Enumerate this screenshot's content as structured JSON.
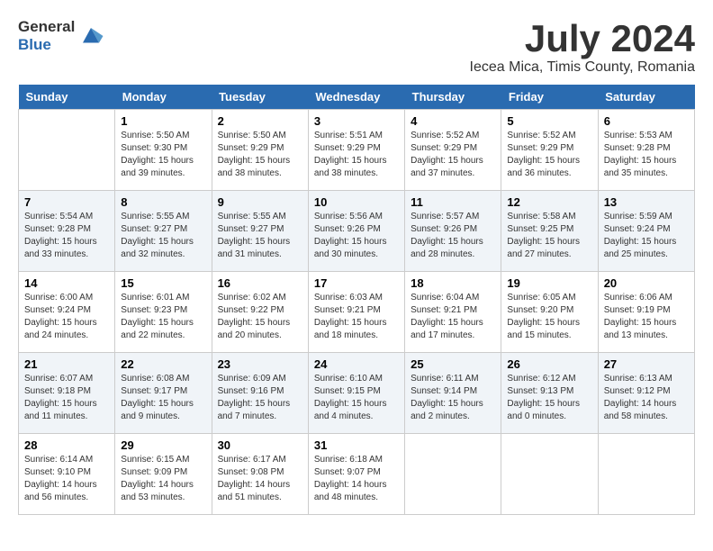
{
  "header": {
    "logo_line1": "General",
    "logo_line2": "Blue",
    "month_title": "July 2024",
    "location": "Iecea Mica, Timis County, Romania"
  },
  "days_of_week": [
    "Sunday",
    "Monday",
    "Tuesday",
    "Wednesday",
    "Thursday",
    "Friday",
    "Saturday"
  ],
  "weeks": [
    [
      {
        "num": "",
        "info": ""
      },
      {
        "num": "1",
        "info": "Sunrise: 5:50 AM\nSunset: 9:30 PM\nDaylight: 15 hours\nand 39 minutes."
      },
      {
        "num": "2",
        "info": "Sunrise: 5:50 AM\nSunset: 9:29 PM\nDaylight: 15 hours\nand 38 minutes."
      },
      {
        "num": "3",
        "info": "Sunrise: 5:51 AM\nSunset: 9:29 PM\nDaylight: 15 hours\nand 38 minutes."
      },
      {
        "num": "4",
        "info": "Sunrise: 5:52 AM\nSunset: 9:29 PM\nDaylight: 15 hours\nand 37 minutes."
      },
      {
        "num": "5",
        "info": "Sunrise: 5:52 AM\nSunset: 9:29 PM\nDaylight: 15 hours\nand 36 minutes."
      },
      {
        "num": "6",
        "info": "Sunrise: 5:53 AM\nSunset: 9:28 PM\nDaylight: 15 hours\nand 35 minutes."
      }
    ],
    [
      {
        "num": "7",
        "info": "Sunrise: 5:54 AM\nSunset: 9:28 PM\nDaylight: 15 hours\nand 33 minutes."
      },
      {
        "num": "8",
        "info": "Sunrise: 5:55 AM\nSunset: 9:27 PM\nDaylight: 15 hours\nand 32 minutes."
      },
      {
        "num": "9",
        "info": "Sunrise: 5:55 AM\nSunset: 9:27 PM\nDaylight: 15 hours\nand 31 minutes."
      },
      {
        "num": "10",
        "info": "Sunrise: 5:56 AM\nSunset: 9:26 PM\nDaylight: 15 hours\nand 30 minutes."
      },
      {
        "num": "11",
        "info": "Sunrise: 5:57 AM\nSunset: 9:26 PM\nDaylight: 15 hours\nand 28 minutes."
      },
      {
        "num": "12",
        "info": "Sunrise: 5:58 AM\nSunset: 9:25 PM\nDaylight: 15 hours\nand 27 minutes."
      },
      {
        "num": "13",
        "info": "Sunrise: 5:59 AM\nSunset: 9:24 PM\nDaylight: 15 hours\nand 25 minutes."
      }
    ],
    [
      {
        "num": "14",
        "info": "Sunrise: 6:00 AM\nSunset: 9:24 PM\nDaylight: 15 hours\nand 24 minutes."
      },
      {
        "num": "15",
        "info": "Sunrise: 6:01 AM\nSunset: 9:23 PM\nDaylight: 15 hours\nand 22 minutes."
      },
      {
        "num": "16",
        "info": "Sunrise: 6:02 AM\nSunset: 9:22 PM\nDaylight: 15 hours\nand 20 minutes."
      },
      {
        "num": "17",
        "info": "Sunrise: 6:03 AM\nSunset: 9:21 PM\nDaylight: 15 hours\nand 18 minutes."
      },
      {
        "num": "18",
        "info": "Sunrise: 6:04 AM\nSunset: 9:21 PM\nDaylight: 15 hours\nand 17 minutes."
      },
      {
        "num": "19",
        "info": "Sunrise: 6:05 AM\nSunset: 9:20 PM\nDaylight: 15 hours\nand 15 minutes."
      },
      {
        "num": "20",
        "info": "Sunrise: 6:06 AM\nSunset: 9:19 PM\nDaylight: 15 hours\nand 13 minutes."
      }
    ],
    [
      {
        "num": "21",
        "info": "Sunrise: 6:07 AM\nSunset: 9:18 PM\nDaylight: 15 hours\nand 11 minutes."
      },
      {
        "num": "22",
        "info": "Sunrise: 6:08 AM\nSunset: 9:17 PM\nDaylight: 15 hours\nand 9 minutes."
      },
      {
        "num": "23",
        "info": "Sunrise: 6:09 AM\nSunset: 9:16 PM\nDaylight: 15 hours\nand 7 minutes."
      },
      {
        "num": "24",
        "info": "Sunrise: 6:10 AM\nSunset: 9:15 PM\nDaylight: 15 hours\nand 4 minutes."
      },
      {
        "num": "25",
        "info": "Sunrise: 6:11 AM\nSunset: 9:14 PM\nDaylight: 15 hours\nand 2 minutes."
      },
      {
        "num": "26",
        "info": "Sunrise: 6:12 AM\nSunset: 9:13 PM\nDaylight: 15 hours\nand 0 minutes."
      },
      {
        "num": "27",
        "info": "Sunrise: 6:13 AM\nSunset: 9:12 PM\nDaylight: 14 hours\nand 58 minutes."
      }
    ],
    [
      {
        "num": "28",
        "info": "Sunrise: 6:14 AM\nSunset: 9:10 PM\nDaylight: 14 hours\nand 56 minutes."
      },
      {
        "num": "29",
        "info": "Sunrise: 6:15 AM\nSunset: 9:09 PM\nDaylight: 14 hours\nand 53 minutes."
      },
      {
        "num": "30",
        "info": "Sunrise: 6:17 AM\nSunset: 9:08 PM\nDaylight: 14 hours\nand 51 minutes."
      },
      {
        "num": "31",
        "info": "Sunrise: 6:18 AM\nSunset: 9:07 PM\nDaylight: 14 hours\nand 48 minutes."
      },
      {
        "num": "",
        "info": ""
      },
      {
        "num": "",
        "info": ""
      },
      {
        "num": "",
        "info": ""
      }
    ]
  ]
}
